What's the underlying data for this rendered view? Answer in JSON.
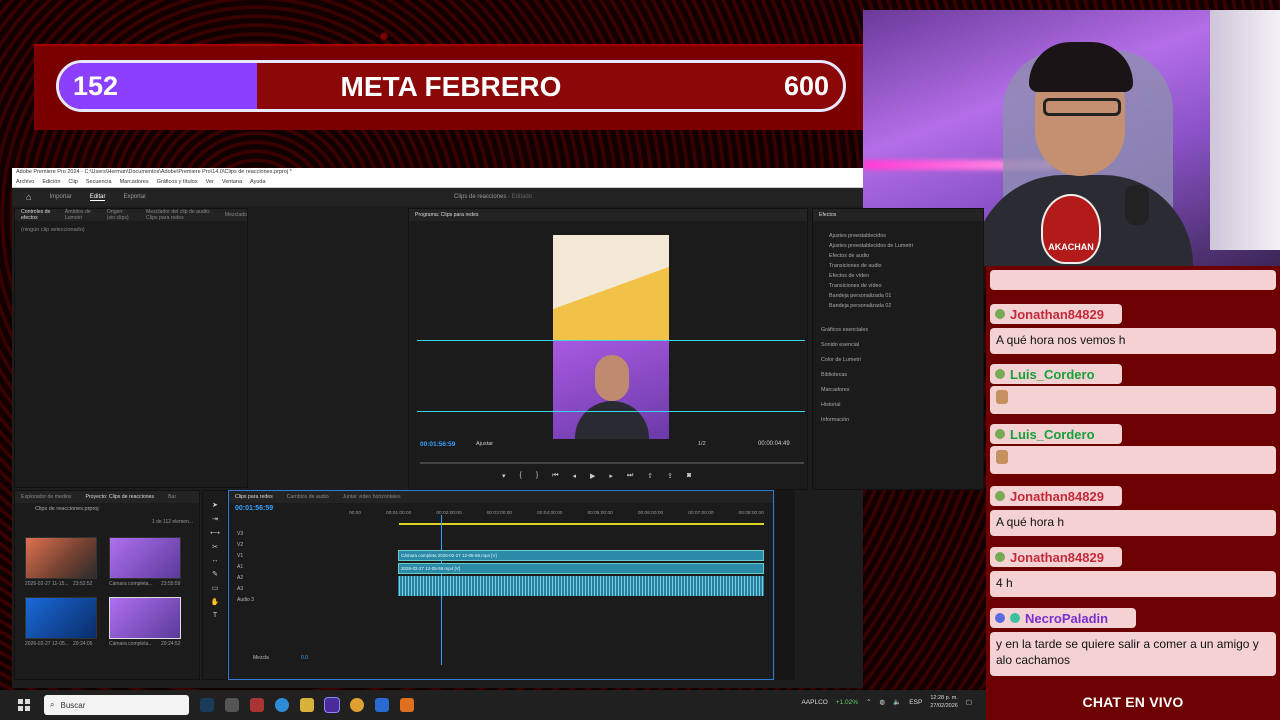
{
  "goal": {
    "current": "152",
    "title": "META FEBRERO",
    "max": "600",
    "progress_fraction": 0.253,
    "fill_color": "#8b40ff"
  },
  "webcam": {
    "badge_text": "AKACHAN"
  },
  "premiere": {
    "title": "Adobe Premiere Pro 2024 - C:\\Users\\Herman\\Documentos\\Adobe\\Premiere Pro\\14.0\\Clips de reacciones.prproj *",
    "menu": [
      "Archivo",
      "Edición",
      "Clip",
      "Secuencia",
      "Marcadores",
      "Gráficos y títulos",
      "Ver",
      "Ventana",
      "Ayuda"
    ],
    "workspace_tabs": [
      "Importar",
      "Editar",
      "Exportar"
    ],
    "active_tab": "Editar",
    "project_name": "Clips de reacciones",
    "project_status": "- Editado",
    "source_tabs": [
      "Controles de efectos",
      "Ámbitos de Lumetri",
      "Origen: (sin clips)",
      "Mezclador del clip de audio: Clips para redes",
      "Mezclado"
    ],
    "no_clip": "(ningún clip seleccionado)",
    "program_title": "Programa: Clips para redes",
    "program_timecode": "00:01:56:59",
    "fit_label": "Ajustar",
    "resolution": "1/2",
    "duration": "00:00:04:49",
    "effects_title": "Efectos",
    "effects_items": [
      "Ajustes preestablecidos",
      "Ajustes preestablecidos de Lumetri",
      "Efectos de audio",
      "Transiciones de audio",
      "Efectos de vídeo",
      "Transiciones de vídeo",
      "Bandeja personalizada 01",
      "Bandeja personalizada 02"
    ],
    "side_panels": [
      "Gráficos esenciales",
      "Sonido esencial",
      "Color de Lumetri",
      "Bibliotecas",
      "Marcadores",
      "Historial",
      "Información"
    ],
    "project_tabs": [
      "Explorador de medios",
      "Proyecto: Clips de reacciones",
      "Bar"
    ],
    "project_file": "Clips de reacciones.prproj",
    "project_count": "1 de 112 elemen...",
    "thumbnails": [
      {
        "label": "2026-02-27 11-15...",
        "dur": "23:52:52"
      },
      {
        "label": "Cámara completa...",
        "dur": "23:55:59"
      },
      {
        "label": "2026-02-27 12-05...",
        "dur": "20:24:05"
      },
      {
        "label": "Cámara completa...",
        "dur": "20:24:52"
      }
    ],
    "timeline_tabs": [
      "Clips para redes",
      "Cambios de audio",
      "Juntar vídeo horizontales"
    ],
    "timeline_timecode": "00:01:56:59",
    "ruler": [
      "00:00",
      "00:01:00:00",
      "00:02:00:00",
      "00:03:00:00",
      "00:04:00:00",
      "00:05:00:00",
      "00:06:00:00",
      "00:07:00:00",
      "00:08:00:00"
    ],
    "tracks": [
      "V3",
      "V2",
      "V1",
      "A1",
      "A2",
      "A3",
      "Audio 3",
      "Mezcla"
    ],
    "clip_v2": "Cámara completa 2026-02-27 12-05-59.mp4 [V]",
    "clip_v1": "2026-02-27 12-05-59.mp4 [V]",
    "mix_value": "0.0"
  },
  "taskbar": {
    "search_placeholder": "Buscar",
    "stock": "AAPLCO",
    "stock_change": "+1.02%",
    "lang": "ESP",
    "time": "12:28 p. m.",
    "date": "27/02/2026"
  },
  "chat": {
    "title": "CHAT EN VIVO",
    "messages": [
      {
        "user": "Jonathan84829",
        "text": "A qué hora nos vemos h",
        "user_color": "#c42a3a"
      },
      {
        "user": "Luis_Cordero",
        "text": "",
        "user_color": "#16a03a"
      },
      {
        "user": "Luis_Cordero",
        "text": "",
        "user_color": "#16a03a"
      },
      {
        "user": "Jonathan84829",
        "text": "A qué hora h",
        "user_color": "#c42a3a"
      },
      {
        "user": "Jonathan84829",
        "text": "4 h",
        "user_color": "#c42a3a"
      },
      {
        "user": "NecroPaladin",
        "text": "y en la tarde se quiere salir a comer a un amigo y alo cachamos",
        "user_color": "#7a2fd0"
      }
    ]
  }
}
